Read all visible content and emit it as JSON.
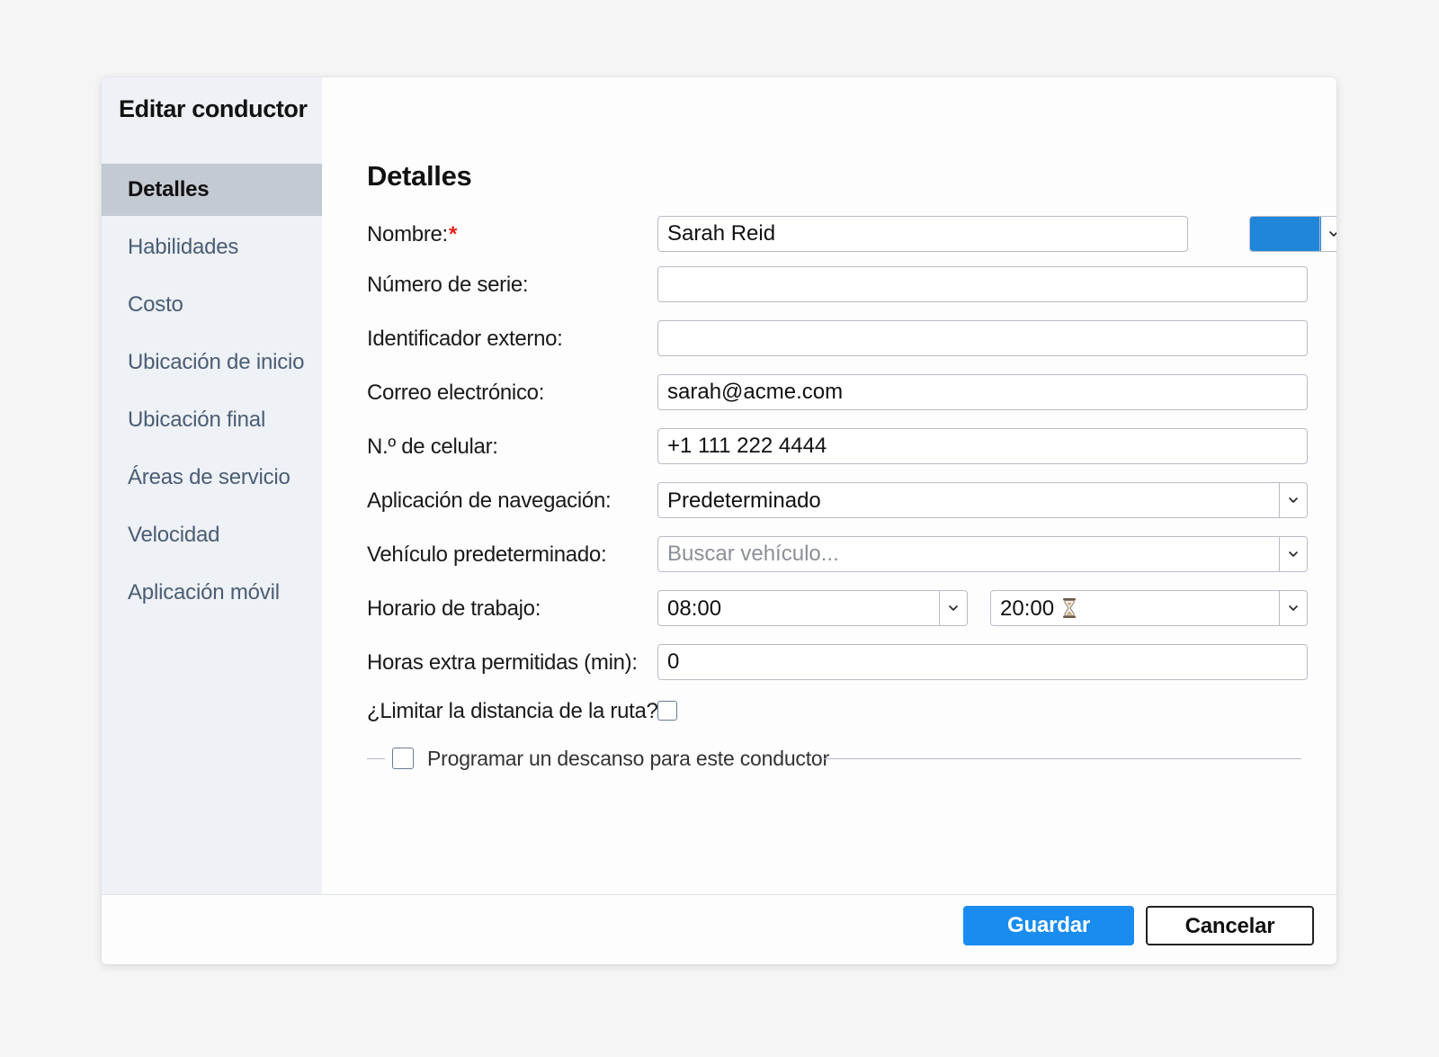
{
  "dialog": {
    "title": "Editar conductor"
  },
  "sidebar": {
    "items": [
      {
        "label": "Detalles",
        "active": true
      },
      {
        "label": "Habilidades",
        "active": false
      },
      {
        "label": "Costo",
        "active": false
      },
      {
        "label": "Ubicación de inicio",
        "active": false
      },
      {
        "label": "Ubicación final",
        "active": false
      },
      {
        "label": "Áreas de servicio",
        "active": false
      },
      {
        "label": "Velocidad",
        "active": false
      },
      {
        "label": "Aplicación móvil",
        "active": false
      }
    ]
  },
  "form": {
    "section_title": "Detalles",
    "name": {
      "label": "Nombre:",
      "required_mark": "*",
      "value": "Sarah Reid"
    },
    "color": {
      "value": "#1f86d9",
      "icon": "chevron-down-icon"
    },
    "serial": {
      "label": "Número de serie:",
      "value": ""
    },
    "external_id": {
      "label": "Identificador externo:",
      "value": ""
    },
    "email": {
      "label": "Correo electrónico:",
      "value": "sarah@acme.com"
    },
    "phone": {
      "label": "N.º de celular:",
      "value": "+1 111 222 4444"
    },
    "nav_app": {
      "label": "Aplicación de navegación:",
      "value": "Predeterminado"
    },
    "vehicle": {
      "label": "Vehículo predeterminado:",
      "placeholder": "Buscar vehículo..."
    },
    "work_hours": {
      "label": "Horario de trabajo:",
      "start": "08:00",
      "end": "20:00",
      "end_icon": "hourglass-icon"
    },
    "overtime": {
      "label": "Horas extra permitidas (min):",
      "value": "0"
    },
    "limit_distance": {
      "label": "¿Limitar la distancia de la ruta?",
      "checked": false
    },
    "break": {
      "label": "Programar un descanso para este conductor",
      "checked": false
    }
  },
  "footer": {
    "save_label": "Guardar",
    "cancel_label": "Cancelar"
  },
  "colors": {
    "primary": "#1a8cf0",
    "sidebar_bg": "#eef1f5",
    "sidebar_active": "#c4cad2",
    "sidebar_text": "#4a5d75",
    "required": "#e5231b"
  }
}
